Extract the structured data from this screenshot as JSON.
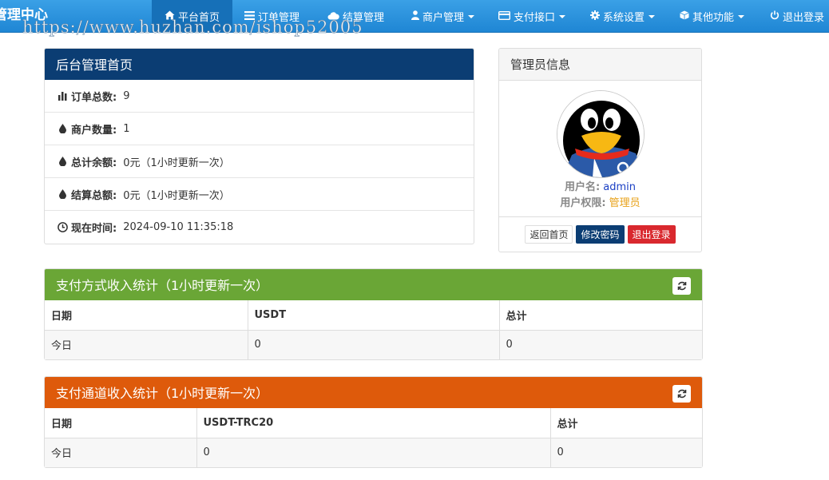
{
  "navbar": {
    "brand": "管理中心",
    "watermark": "https://www.huzhan.com/ishop52005",
    "items": [
      {
        "label": "平台首页",
        "icon": "home-icon",
        "active": true,
        "dropdown": false
      },
      {
        "label": "订单管理",
        "icon": "list-icon",
        "active": false,
        "dropdown": false
      },
      {
        "label": "结算管理",
        "icon": "cloud-icon",
        "active": false,
        "dropdown": false
      },
      {
        "label": "商户管理",
        "icon": "user-icon",
        "active": false,
        "dropdown": true
      },
      {
        "label": "支付接口",
        "icon": "credit-card-icon",
        "active": false,
        "dropdown": true
      },
      {
        "label": "系统设置",
        "icon": "gear-icon",
        "active": false,
        "dropdown": true
      },
      {
        "label": "其他功能",
        "icon": "cube-icon",
        "active": false,
        "dropdown": true
      },
      {
        "label": "退出登录",
        "icon": "power-icon",
        "active": false,
        "dropdown": false
      }
    ]
  },
  "overview": {
    "title": "后台管理首页",
    "rows": [
      {
        "icon": "bar-chart-icon",
        "label": "订单总数:",
        "value": "9"
      },
      {
        "icon": "drop-icon",
        "label": "商户数量:",
        "value": "1"
      },
      {
        "icon": "drop-icon",
        "label": "总计余额:",
        "value": "0元（1小时更新一次）"
      },
      {
        "icon": "drop-icon",
        "label": "结算总额:",
        "value": "0元（1小时更新一次）"
      },
      {
        "icon": "clock-icon",
        "label": "现在时间:",
        "value": "2024-09-10 11:35:18"
      }
    ]
  },
  "admin": {
    "title": "管理员信息",
    "username_label": "用户名:",
    "username": "admin",
    "role_label": "用户权限:",
    "role": "管理员",
    "buttons": {
      "home": "返回首页",
      "change_password": "修改密码",
      "logout": "退出登录"
    }
  },
  "stat_method": {
    "title": "支付方式收入统计（1小时更新一次）",
    "columns": [
      "日期",
      "USDT",
      "总计"
    ],
    "rows": [
      [
        "今日",
        "0",
        "0"
      ]
    ]
  },
  "stat_channel": {
    "title": "支付通道收入统计（1小时更新一次）",
    "columns": [
      "日期",
      "USDT-TRC20",
      "总计"
    ],
    "rows": [
      [
        "今日",
        "0",
        "0"
      ]
    ]
  },
  "colors": {
    "navbar": "#2e93dc",
    "overview_header": "#0b3d73",
    "method_header": "#6aa636",
    "channel_header": "#de5a0b",
    "danger": "#d9282e",
    "role_text": "#e8a21a"
  }
}
